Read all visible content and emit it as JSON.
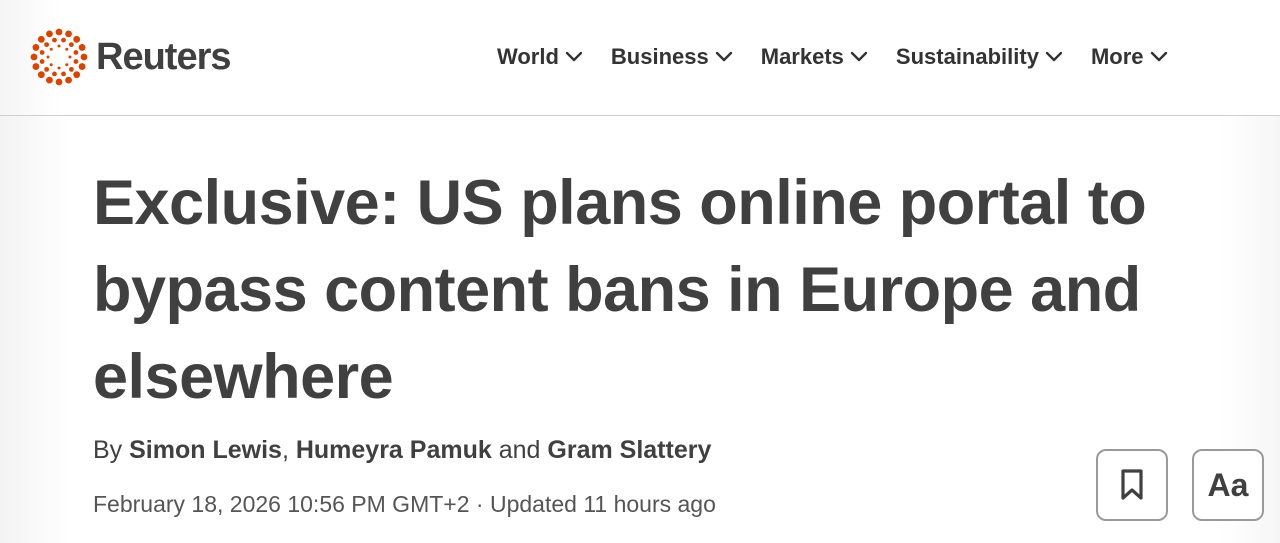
{
  "brand": {
    "name": "Reuters",
    "logo_icon": "reuters-dot-ring-logo",
    "accent_color": "#dc4300"
  },
  "nav": {
    "items": [
      {
        "label": "World",
        "icon": "chevron-down-icon"
      },
      {
        "label": "Business",
        "icon": "chevron-down-icon"
      },
      {
        "label": "Markets",
        "icon": "chevron-down-icon"
      },
      {
        "label": "Sustainability",
        "icon": "chevron-down-icon"
      },
      {
        "label": "More",
        "icon": "chevron-down-icon"
      }
    ]
  },
  "article": {
    "headline": "Exclusive: US plans online portal to bypass content bans in Europe and elsewhere",
    "byline": {
      "prefix": "By ",
      "authors": [
        "Simon Lewis",
        "Humeyra Pamuk",
        "Gram Slattery"
      ],
      "separator": ", ",
      "conjunction": " and "
    },
    "date": "February 18, 2026 10:56 PM GMT+2",
    "date_separator": " · ",
    "updated": "Updated 11 hours ago"
  },
  "actions": {
    "bookmark_icon": "bookmark-icon",
    "text_size_label": "Aa"
  },
  "colors": {
    "text": "#404040",
    "border": "#9a9a9a",
    "divider": "#cfcfcf"
  }
}
